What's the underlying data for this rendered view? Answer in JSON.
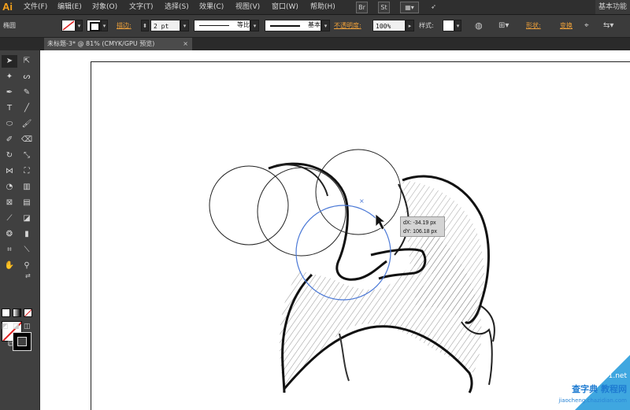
{
  "app": {
    "logo": "Ai",
    "workspace": "基本功能"
  },
  "menu": [
    {
      "id": "file",
      "label": "文件(F)"
    },
    {
      "id": "edit",
      "label": "编辑(E)"
    },
    {
      "id": "object",
      "label": "对象(O)"
    },
    {
      "id": "type",
      "label": "文字(T)"
    },
    {
      "id": "select",
      "label": "选择(S)"
    },
    {
      "id": "effect",
      "label": "效果(C)"
    },
    {
      "id": "view",
      "label": "视图(V)"
    },
    {
      "id": "window",
      "label": "窗口(W)"
    },
    {
      "id": "help",
      "label": "帮助(H)"
    }
  ],
  "menu_icons": {
    "bridge": "Br",
    "stock": "St"
  },
  "control": {
    "selection_type": "椭圆",
    "stroke_label": "描边:",
    "stroke_weight": "2 pt",
    "profile_label": "等比",
    "brush_label": "基本",
    "opacity_label": "不透明度:",
    "opacity_value": "100%",
    "style_label": "样式:",
    "shape_label": "形状:",
    "transform_label": "变换"
  },
  "document_tab": {
    "title": "未标题-3* @ 81% (CMYK/GPU 预览)",
    "close": "×"
  },
  "tooltip": {
    "dx": "dX: -34.19 px",
    "dy": "dY: 106.18 px"
  },
  "watermark": {
    "line1": "查字典 教程网",
    "line2": "jiaocheng.chazidian.com",
    "corner": "jb51.net"
  }
}
